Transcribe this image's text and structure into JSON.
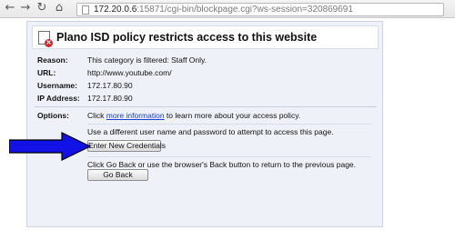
{
  "browser": {
    "url_host": "172.20.0.6",
    "url_rest": ":15871/cgi-bin/blockpage.cgi?ws-session=320869691",
    "back_icon": "back-arrow-icon",
    "forward_icon": "forward-arrow-icon",
    "reload_icon": "reload-icon",
    "home_icon": "home-icon"
  },
  "block_page": {
    "title": "Plano ISD policy restricts access to this website",
    "fields": [
      {
        "label": "Reason:",
        "value": "This category is filtered: Staff Only."
      },
      {
        "label": "URL:",
        "value": "http://www.youtube.com/"
      },
      {
        "label": "Username:",
        "value": "172.17.80.90"
      },
      {
        "label": "IP Address:",
        "value": "172.17.80.90"
      }
    ],
    "options_label": "Options:",
    "info_prefix": "Click ",
    "info_link": "more information",
    "info_suffix": " to learn more about your access policy.",
    "credentials_text": "Use a different user name and password to attempt to access this page.",
    "credentials_button": "Enter New Credentials",
    "goback_text": "Click Go Back or use the browser's Back button to return to the previous page.",
    "goback_button": "Go Back"
  },
  "colors": {
    "panel_bg": "#eef2f8",
    "link": "#1a3fd6",
    "arrow": "#1212e6",
    "block_icon_red": "#d3262b"
  }
}
